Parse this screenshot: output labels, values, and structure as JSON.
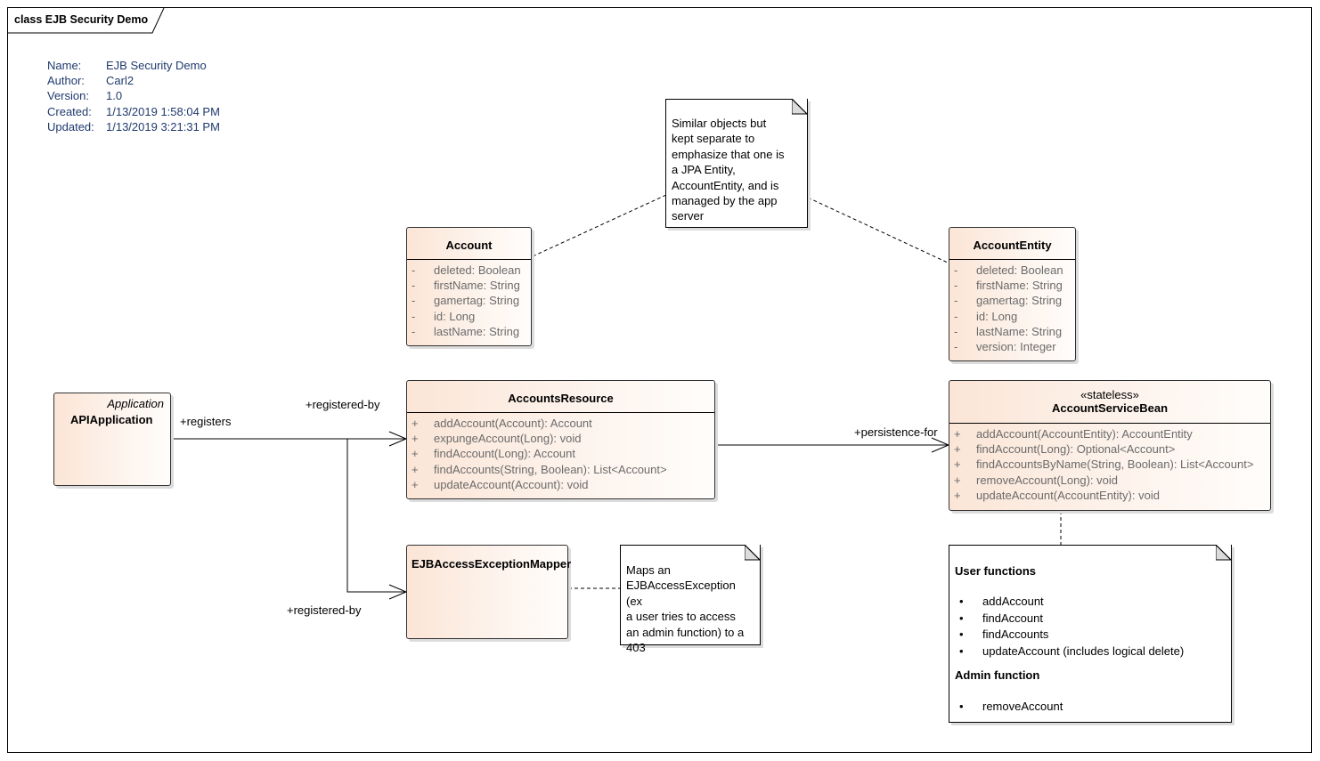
{
  "diagram": {
    "frame_title": "class EJB Security Demo",
    "metadata": [
      {
        "key": "Name:",
        "value": "EJB Security Demo"
      },
      {
        "key": "Author:",
        "value": "Carl2"
      },
      {
        "key": "Version:",
        "value": "1.0"
      },
      {
        "key": "Created:",
        "value": "1/13/2019 1:58:04 PM"
      },
      {
        "key": "Updated:",
        "value": "1/13/2019 3:21:31 PM"
      }
    ]
  },
  "classes": {
    "account": {
      "name": "Account",
      "attributes": [
        {
          "vis": "-",
          "text": "deleted: Boolean"
        },
        {
          "vis": "-",
          "text": "firstName: String"
        },
        {
          "vis": "-",
          "text": "gamertag: String"
        },
        {
          "vis": "-",
          "text": "id: Long"
        },
        {
          "vis": "-",
          "text": "lastName: String"
        }
      ]
    },
    "account_entity": {
      "name": "AccountEntity",
      "attributes": [
        {
          "vis": "-",
          "text": "deleted: Boolean"
        },
        {
          "vis": "-",
          "text": "firstName: String"
        },
        {
          "vis": "-",
          "text": "gamertag: String"
        },
        {
          "vis": "-",
          "text": "id: Long"
        },
        {
          "vis": "-",
          "text": "lastName: String"
        },
        {
          "vis": "-",
          "text": "version: Integer"
        }
      ]
    },
    "api_application": {
      "name": "APIApplication",
      "parent": "Application"
    },
    "accounts_resource": {
      "name": "AccountsResource",
      "operations": [
        {
          "vis": "+",
          "text": "addAccount(Account): Account"
        },
        {
          "vis": "+",
          "text": "expungeAccount(Long): void"
        },
        {
          "vis": "+",
          "text": "findAccount(Long): Account"
        },
        {
          "vis": "+",
          "text": "findAccounts(String, Boolean): List<Account>"
        },
        {
          "vis": "+",
          "text": "updateAccount(Account): void"
        }
      ]
    },
    "account_service_bean": {
      "stereotype": "«stateless»",
      "name": "AccountServiceBean",
      "operations": [
        {
          "vis": "+",
          "text": "addAccount(AccountEntity): AccountEntity"
        },
        {
          "vis": "+",
          "text": "findAccount(Long): Optional<Account>"
        },
        {
          "vis": "+",
          "text": "findAccountsByName(String, Boolean): List<Account>"
        },
        {
          "vis": "+",
          "text": "removeAccount(Long): void"
        },
        {
          "vis": "+",
          "text": "updateAccount(AccountEntity): void"
        }
      ]
    },
    "ejb_mapper": {
      "name": "EJBAccessExceptionMapper"
    }
  },
  "notes": {
    "similar_objects": {
      "lines": [
        "Similar objects but",
        "kept separate to",
        "emphasize that one is",
        "a JPA Entity,",
        "AccountEntity, and is",
        "managed by the app",
        "server"
      ]
    },
    "maps_exception": {
      "lines": [
        "Maps an",
        "EJBAccessException (ex",
        "a user tries to access",
        "an admin function) to a",
        "403"
      ]
    },
    "functions": {
      "user_heading": "User functions",
      "user_items": [
        "addAccount",
        "findAccount",
        "findAccounts",
        "updateAccount (includes logical delete)"
      ],
      "admin_heading": "Admin function",
      "admin_items": [
        "removeAccount"
      ],
      "bullet": "•"
    }
  },
  "connector_labels": {
    "registers": "+registers",
    "registered_by_top": "+registered-by",
    "registered_by_bottom": "+registered-by",
    "persistence_for": "+persistence-for"
  }
}
